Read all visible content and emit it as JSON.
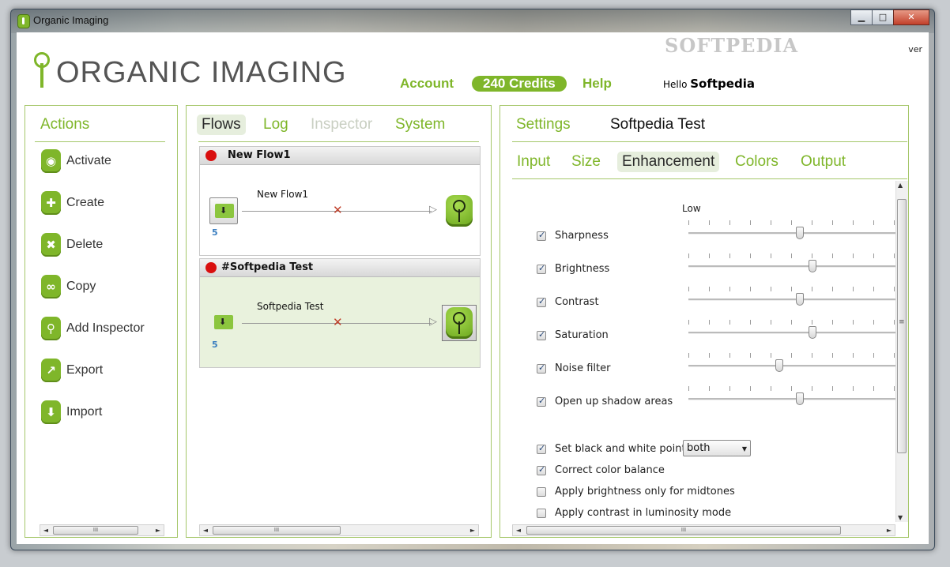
{
  "window": {
    "title": "Organic Imaging",
    "minimize": "0",
    "maximize": "1",
    "close": "r"
  },
  "watermark": "SOFTPEDIA",
  "logo": {
    "text": "ORGANIC IMAGING"
  },
  "nav": {
    "account": "Account",
    "credits": "240 Credits",
    "help": "Help"
  },
  "greeting": {
    "hello": "Hello",
    "user": "Softpedia"
  },
  "version": "ver",
  "actions": {
    "title": "Actions",
    "items": [
      {
        "label": "Activate",
        "icon": "activate-icon",
        "glyph": "◉"
      },
      {
        "label": "Create",
        "icon": "plus-icon",
        "glyph": "✚"
      },
      {
        "label": "Delete",
        "icon": "delete-x-icon",
        "glyph": "✖"
      },
      {
        "label": "Copy",
        "icon": "copy-link-icon",
        "glyph": "∞"
      },
      {
        "label": "Add Inspector",
        "icon": "magnifier-icon",
        "glyph": "⚲"
      },
      {
        "label": "Export",
        "icon": "export-arrow-icon",
        "glyph": "↗"
      },
      {
        "label": "Import",
        "icon": "import-arrow-icon",
        "glyph": "⬇"
      }
    ]
  },
  "scrollbar": {
    "grip": "III",
    "left": "◄",
    "right": "►",
    "up": "▲",
    "down": "▼",
    "vgrip": "≡"
  },
  "flows_panel": {
    "tabs": [
      "Flows",
      "Log",
      "Inspector",
      "System"
    ],
    "flows": [
      {
        "header": "New Flow1",
        "label": "New Flow1",
        "count": "5"
      },
      {
        "header": "#Softpedia Test",
        "label": "Softpedia Test",
        "count": "5"
      }
    ]
  },
  "settings": {
    "title": "Settings",
    "flow_name": "Softpedia Test",
    "tabs": [
      "Input",
      "Size",
      "Enhancement",
      "Colors",
      "Output"
    ],
    "scale_label": "Low",
    "sliders": [
      {
        "label": "Sharpness",
        "checked": true,
        "level": 0.54
      },
      {
        "label": "Brightness",
        "checked": true,
        "level": 0.6
      },
      {
        "label": "Contrast",
        "checked": true,
        "level": 0.54
      },
      {
        "label": "Saturation",
        "checked": true,
        "level": 0.6
      },
      {
        "label": "Noise filter",
        "checked": true,
        "level": 0.44
      },
      {
        "label": "Open up shadow areas",
        "checked": true,
        "level": 0.54
      }
    ],
    "options": [
      {
        "label": "Set black and white point",
        "checked": true
      },
      {
        "label": "Correct color balance",
        "checked": true
      },
      {
        "label": "Apply brightness only for midtones",
        "checked": false
      },
      {
        "label": "Apply contrast in luminosity mode",
        "checked": false
      }
    ],
    "bw_select": "both"
  },
  "colors": {
    "accent": "#7fb62a",
    "status_red": "#d90f0f",
    "link_blue": "#3a7ec0"
  }
}
